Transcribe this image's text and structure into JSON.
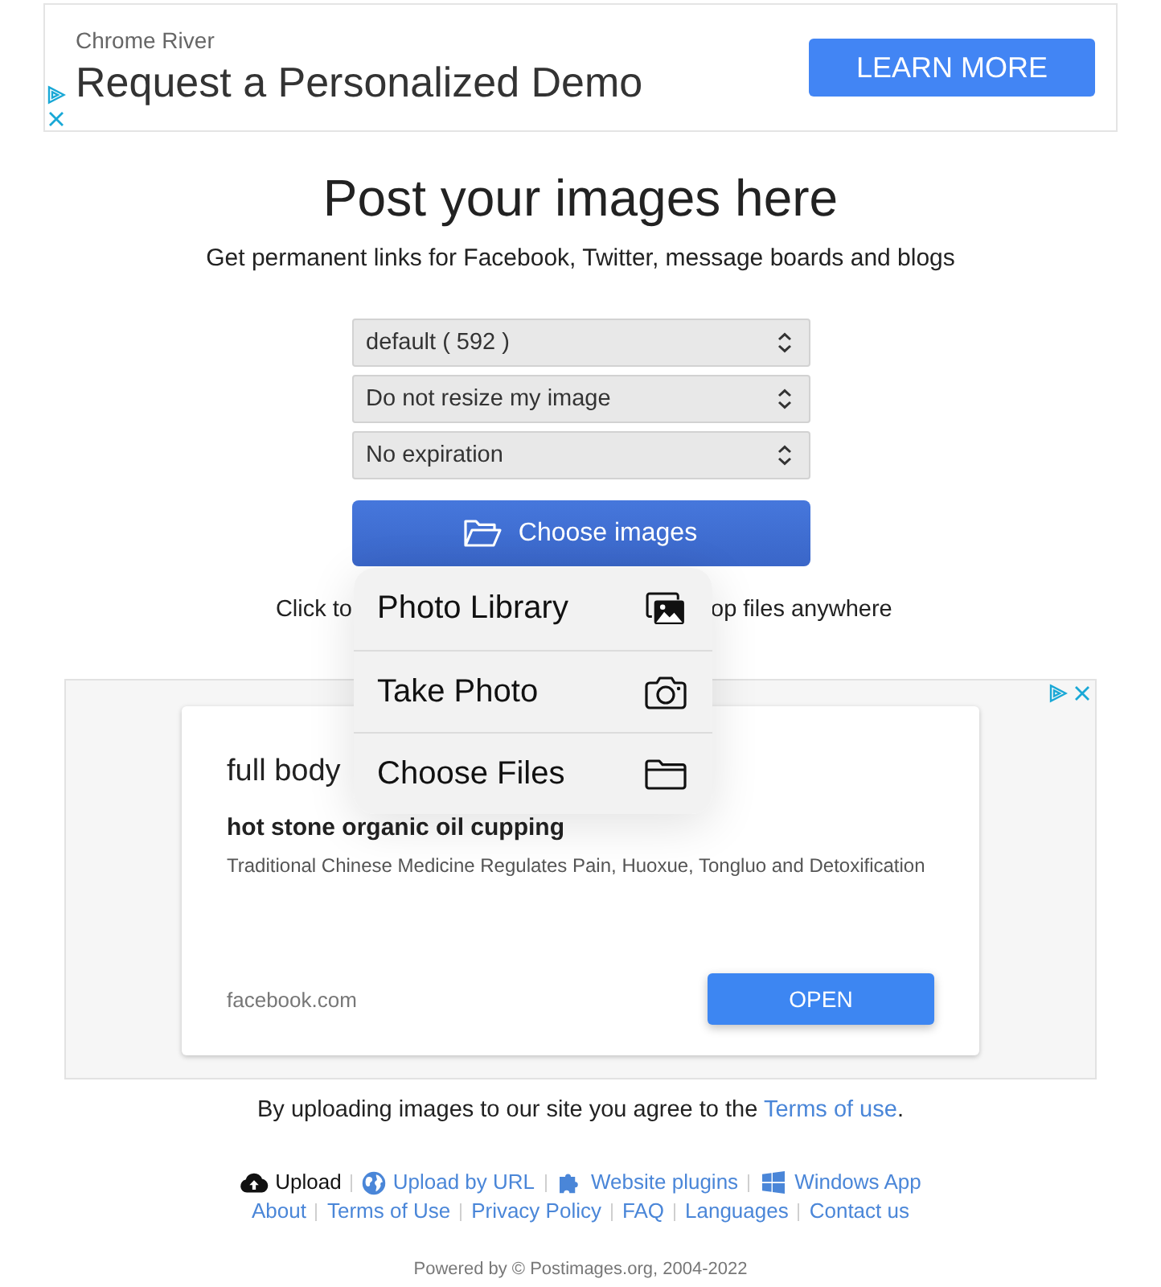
{
  "top_ad": {
    "advertiser": "Chrome River",
    "headline": "Request a Personalized Demo",
    "button": "LEARN MORE"
  },
  "title": "Post your images here",
  "subtitle": "Get permanent links for Facebook, Twitter, message boards and blogs",
  "selects": [
    {
      "value": "default ( 592 )"
    },
    {
      "value": "Do not resize my image"
    },
    {
      "value": "No expiration"
    }
  ],
  "choose_button": "Choose images",
  "hint": {
    "before": "Click to",
    "after": "op files anywhere"
  },
  "popup_menu": [
    {
      "label": "Photo Library",
      "kind": "library"
    },
    {
      "label": "Take Photo",
      "kind": "camera"
    },
    {
      "label": "Choose Files",
      "kind": "files"
    }
  ],
  "middle_ad": {
    "headline": "full body",
    "subheadline": "hot stone organic oil cupping",
    "description": "Traditional Chinese Medicine Regulates Pain, Huoxue, Tongluo and Detoxification",
    "domain": "facebook.com",
    "button": "OPEN"
  },
  "terms_notice": {
    "text": "By uploading images to our site you agree to the",
    "link": "Terms of use",
    "end": "."
  },
  "footer_tools": [
    {
      "label": "Upload",
      "kind": "upload",
      "selected": true
    },
    {
      "label": "Upload by URL",
      "kind": "url",
      "selected": false
    },
    {
      "label": "Website plugins",
      "kind": "plugins",
      "selected": false
    },
    {
      "label": "Windows App",
      "kind": "windows",
      "selected": false
    }
  ],
  "footer_links": [
    "About",
    "Terms of Use",
    "Privacy Policy",
    "FAQ",
    "Languages",
    "Contact us"
  ],
  "copyright": "Powered by © Postimages.org, 2004-2022"
}
